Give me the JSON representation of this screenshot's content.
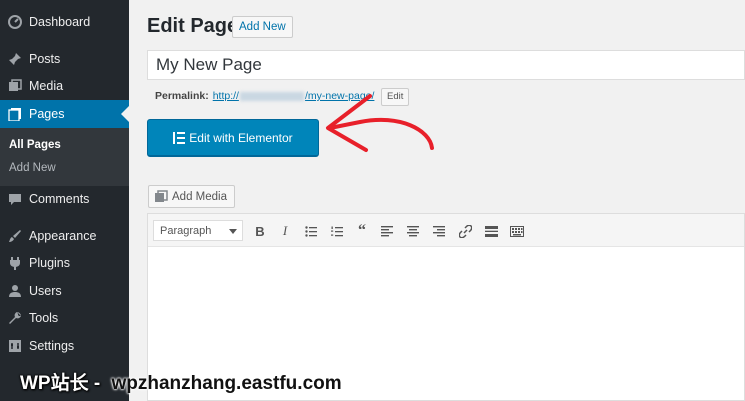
{
  "sidebar": {
    "items": [
      {
        "label": "Dashboard",
        "icon": "dashboard-icon"
      },
      {
        "label": "Posts",
        "icon": "pin-icon"
      },
      {
        "label": "Media",
        "icon": "media-icon"
      },
      {
        "label": "Pages",
        "icon": "pages-icon",
        "active": true
      },
      {
        "label": "Comments",
        "icon": "comment-icon"
      },
      {
        "label": "Appearance",
        "icon": "paintbrush-icon"
      },
      {
        "label": "Plugins",
        "icon": "plugin-icon"
      },
      {
        "label": "Users",
        "icon": "user-icon"
      },
      {
        "label": "Tools",
        "icon": "wrench-icon"
      },
      {
        "label": "Settings",
        "icon": "settings-icon"
      }
    ],
    "submenu": {
      "all_pages": "All Pages",
      "add_new": "Add New"
    }
  },
  "header": {
    "title": "Edit Page",
    "add_new": "Add New"
  },
  "post": {
    "title_value": "My New Page",
    "permalink_label": "Permalink:",
    "permalink_base": "http://",
    "permalink_slug": "/my-new-page/",
    "edit_label": "Edit"
  },
  "elementor": {
    "label": "Edit with Elementor"
  },
  "media": {
    "label": "Add Media"
  },
  "editor": {
    "format_value": "Paragraph"
  },
  "watermark": {
    "text_cn": "WP站长 - ",
    "text_domain": "wpzhanzhang.eastfu.com"
  },
  "colors": {
    "sidebar_bg": "#23282d",
    "accent": "#0073aa",
    "button_blue": "#0085ba",
    "arrow_red": "#e8202a"
  }
}
